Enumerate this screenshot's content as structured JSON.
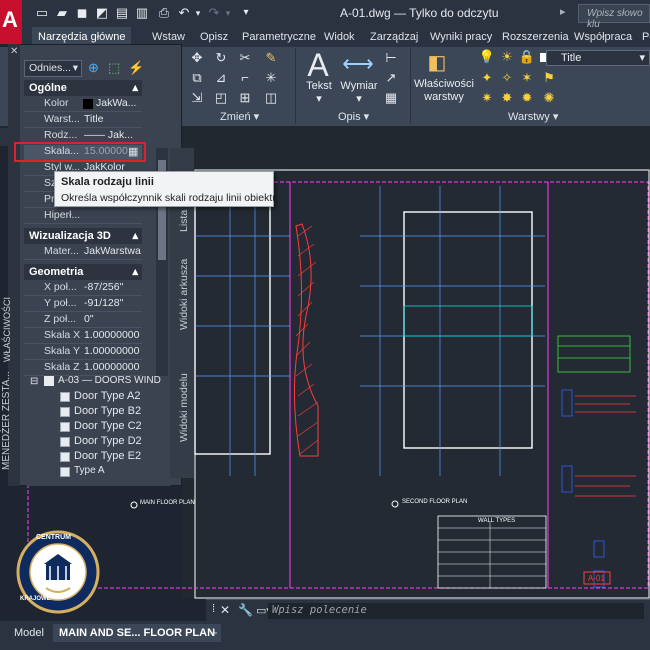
{
  "window": {
    "title": "A-01.dwg — Tylko do odczytu",
    "search_placeholder": "Wpisz słowo klu",
    "logo": "A"
  },
  "ribbon": {
    "tabs": [
      "Narzędzia główne",
      "Wstaw",
      "Opisz",
      "Parametryczne",
      "Widok",
      "Zarządzaj",
      "Wyniki pracy",
      "Rozszerzenia",
      "Współpraca",
      "Polece"
    ],
    "active_tab": "Narzędzia główne",
    "panels": {
      "modify": "Zmień",
      "annotation": "Opis",
      "layers": "Warstwy"
    },
    "buttons": {
      "text": "Tekst",
      "dimension": "Wymiar",
      "properties_line1": "Właściwości",
      "properties_line2": "warstwy"
    },
    "layer_combo": "Title"
  },
  "properties": {
    "filter": "Odnies...",
    "sections": {
      "general": "Ogólne",
      "viz3d": "Wizualizacja 3D",
      "geometry": "Geometria"
    },
    "general": [
      {
        "label": "Kolor",
        "value": "JakWa..."
      },
      {
        "label": "Warst...",
        "value": "Title"
      },
      {
        "label": "Rodz...",
        "value": "—— Jak..."
      },
      {
        "label": "Skala...",
        "value": "15.00000"
      },
      {
        "label": "Styl w...",
        "value": "JakKolor"
      },
      {
        "label": "Sze...",
        "value": ""
      },
      {
        "label": "Pr...",
        "value": ""
      },
      {
        "label": "Hiperł...",
        "value": ""
      }
    ],
    "viz3d": [
      {
        "label": "Mater...",
        "value": "JakWarstwa"
      }
    ],
    "geometry": [
      {
        "label": "X poł...",
        "value": "-87/256\""
      },
      {
        "label": "Y poł...",
        "value": "-91/128\""
      },
      {
        "label": "Z poł...",
        "value": "0\""
      },
      {
        "label": "Skala X",
        "value": "1.00000000"
      },
      {
        "label": "Skala Y",
        "value": "1.00000000"
      },
      {
        "label": "Skala Z",
        "value": "1.00000000"
      }
    ],
    "side_tabs": [
      "Lista",
      "Widoki arkusza",
      "Widoki modelu"
    ],
    "left_vtabs": [
      "MENEDŻER ZESTA...",
      "WŁAŚCIWOŚCI"
    ]
  },
  "tooltip": {
    "title": "Skala rodzaju linii",
    "body": "Określa współczynnik skali rodzaju linii obiektu"
  },
  "layer_tree": {
    "group": "A-03 — DOORS WIND",
    "items": [
      "Door Type A2",
      "Door Type B2",
      "Door Type C2",
      "Door Type D2",
      "Door Type E2",
      "Type A"
    ]
  },
  "drawing": {
    "plan_left": "MAIN FLOOR PLAN",
    "plan_right": "SECOND FLOOR PLAN",
    "table_title": "WALL TYPES",
    "badge_text": "A-01"
  },
  "command_line": {
    "placeholder": "Wpisz polecenie"
  },
  "layout_tabs": {
    "model": "Model",
    "active": "MAIN AND SE... FLOOR PLAN",
    "add": "+"
  },
  "seal": {
    "text_top": "CENTRUM",
    "text_side": "KRAJOWE"
  },
  "colors": {
    "accent_red": "#c8102e",
    "magenta": "#ff3cff",
    "highlight_box": "#e0202a",
    "drawing_blue": "#3060ff"
  }
}
